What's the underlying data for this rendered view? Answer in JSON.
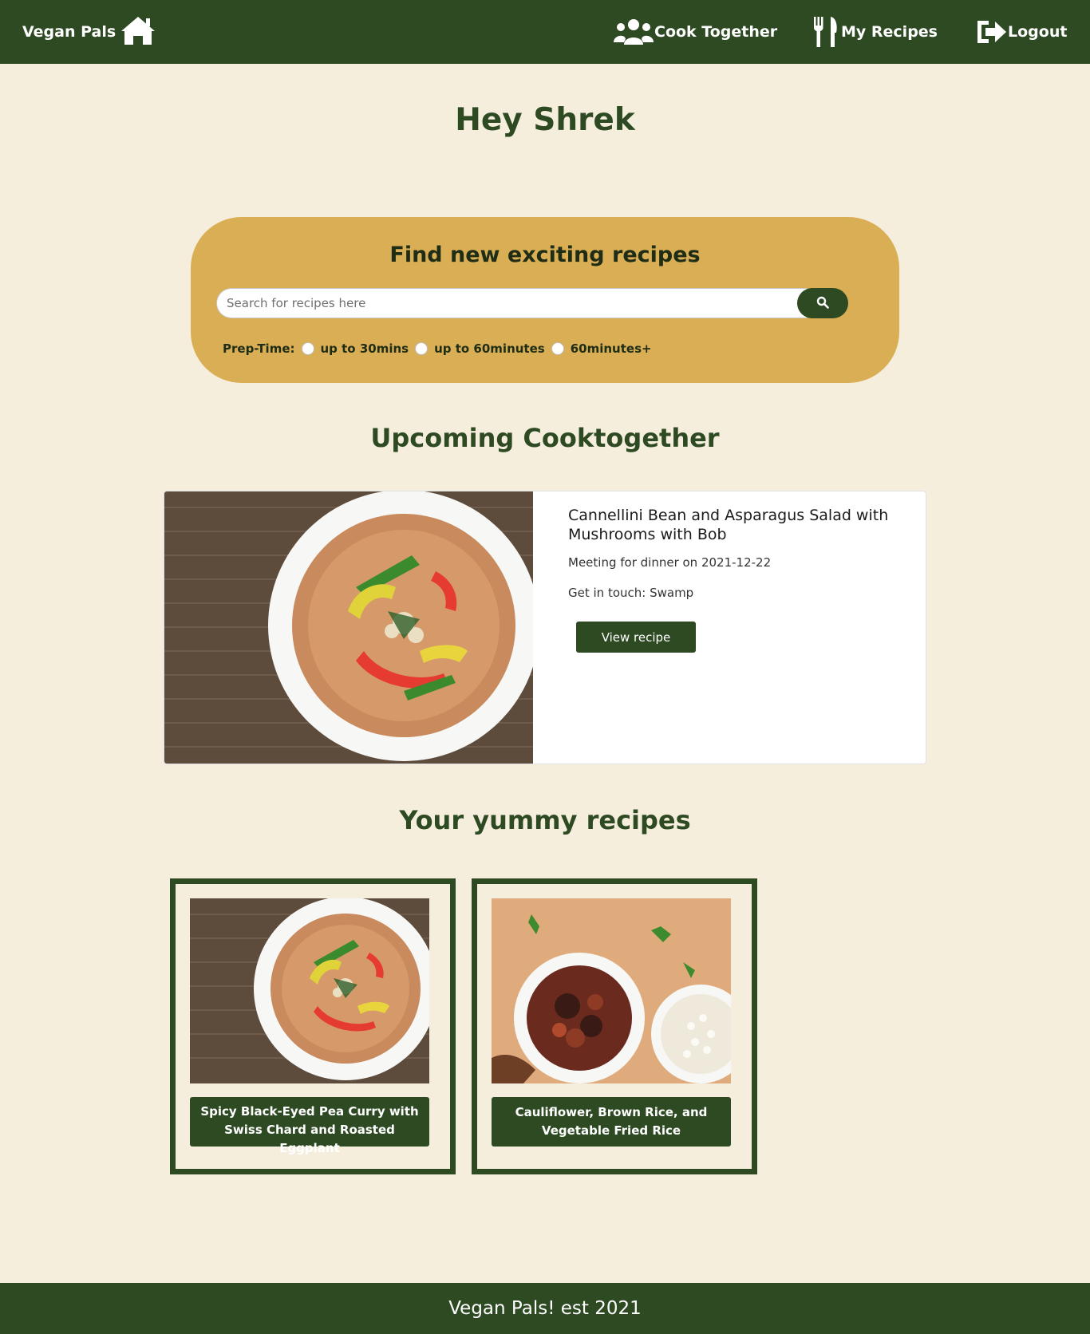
{
  "navbar": {
    "brand": "Vegan Pals",
    "home_icon": "home-icon",
    "items": [
      {
        "label": "Cook Together",
        "icon": "users-icon"
      },
      {
        "label": "My Recipes",
        "icon": "utensils-icon"
      },
      {
        "label": "Logout",
        "icon": "logout-icon"
      }
    ]
  },
  "greeting": "Hey Shrek",
  "search": {
    "title": "Find new exciting recipes",
    "placeholder": "Search for recipes here",
    "value": "",
    "button_icon": "search-icon",
    "prep_label": "Prep-Time:",
    "options": [
      "up to 30mins",
      "up to 60minutes",
      "60minutes+"
    ]
  },
  "upcoming": {
    "heading": "Upcoming Cooktogether",
    "card": {
      "title": "Cannellini Bean and Asparagus Salad with Mushrooms with Bob",
      "meeting": "Meeting for dinner on 2021-12-22",
      "contact": "Get in touch: Swamp",
      "button": "View recipe",
      "image": "curry-bowl-photo"
    }
  },
  "recipes": {
    "heading": "Your yummy recipes",
    "items": [
      {
        "title": "Spicy Black-Eyed Pea Curry with Swiss Chard and Roasted Eggplant",
        "image": "curry-bowl-photo"
      },
      {
        "title": "Cauliflower, Brown Rice, and Vegetable Fried Rice",
        "image": "stew-and-rice-photo"
      }
    ]
  },
  "footer": "Vegan Pals! est 2021",
  "colors": {
    "primary": "#2e4a23",
    "background": "#f6eedd",
    "search_panel": "#d9ae54",
    "white": "#ffffff"
  }
}
